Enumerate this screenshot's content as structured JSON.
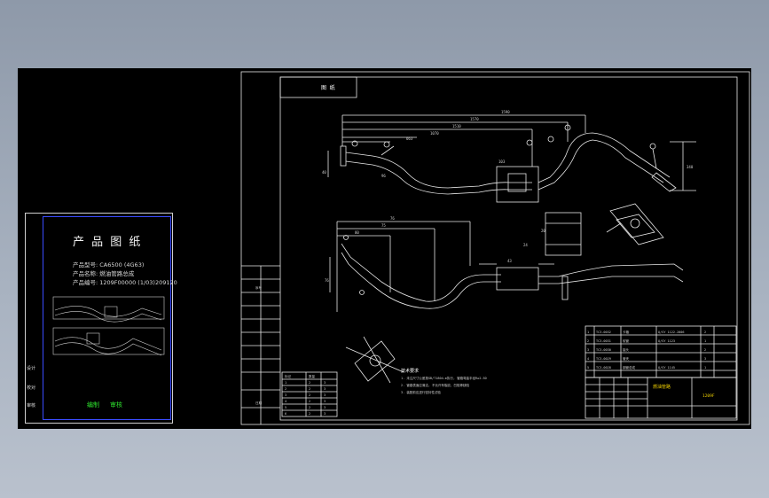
{
  "cover": {
    "title": "产 品 图 纸",
    "lines": [
      "产品型号: CA6500 (4G63)",
      "产品名称: 燃油管路总成",
      "产品编号: 1209F00000 (1/03)209120"
    ],
    "sign_left": "编制",
    "sign_right": "审核",
    "side_labels": [
      "设计",
      "校对",
      "审核"
    ]
  },
  "drawing": {
    "title_box_label": "图 纸",
    "notes_heading": "技术要求",
    "notes": [
      "1. 未注尺寸公差按GB/T1804-m执行, 管路弯曲半径R≥2.5D",
      "2. 管路表面应清洁, 不允许有裂纹、凹陷等缺陷",
      "3. 装配前应进行密封性试验"
    ],
    "dims_top": [
      "1590",
      "1570",
      "1510",
      "1070",
      "663",
      "40",
      "340",
      "103",
      "96",
      "24",
      "20"
    ],
    "dims_bottom": [
      "76",
      "75",
      "80",
      "76",
      "43"
    ],
    "table_small_header": [
      "标记",
      "数量"
    ],
    "table_small_rows": [
      [
        "1",
        "2",
        "3"
      ],
      [
        "2",
        "2",
        "3"
      ],
      [
        "3",
        "2",
        "3"
      ],
      [
        "4",
        "2",
        "3"
      ],
      [
        "5",
        "2",
        "3"
      ],
      [
        "6",
        "2",
        "3"
      ]
    ],
    "bom_rows": [
      [
        "1",
        "TC3-0032",
        "卡箍",
        "Q/SY 1122-2006",
        "2"
      ],
      [
        "2",
        "TC3-0031",
        "软管",
        "Q/SY 1123",
        "1"
      ],
      [
        "3",
        "TC3-0030",
        "接头",
        "",
        "2"
      ],
      [
        "4",
        "TC3-0029",
        "管夹",
        "",
        "3"
      ],
      [
        "5",
        "TC3-0028",
        "钢管总成",
        "Q/SY 1145",
        "1"
      ]
    ],
    "title_block_name": "燃油管路",
    "title_block_code": "1209F",
    "left_strip_labels": [
      "",
      "序号",
      "",
      "",
      "",
      "",
      "",
      "日期"
    ]
  }
}
